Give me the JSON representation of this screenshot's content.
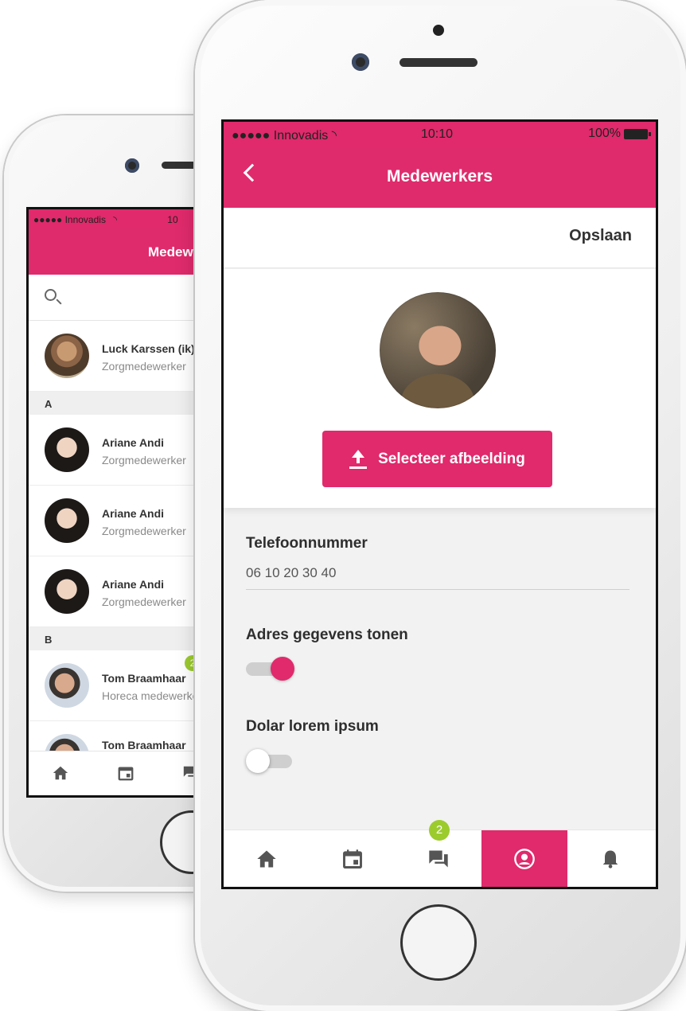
{
  "back_phone": {
    "status": {
      "carrier": "●●●●● Innovadis",
      "time": "10"
    },
    "title": "Medew",
    "contacts": [
      {
        "name": "Luck Karssen (ik)",
        "role": "Zorgmedewerker",
        "avatar": "man"
      }
    ],
    "sections": [
      {
        "letter": "A",
        "items": [
          {
            "name": "Ariane Andi",
            "role": "Zorgmedewerker"
          },
          {
            "name": "Ariane Andi",
            "role": "Zorgmedewerker"
          },
          {
            "name": "Ariane Andi",
            "role": "Zorgmedewerker"
          }
        ]
      },
      {
        "letter": "B",
        "items": [
          {
            "name": "Tom Braamhaar",
            "role": "Horeca medewerker",
            "badge": "2"
          },
          {
            "name": "Tom Braamhaar",
            "role": ""
          }
        ]
      }
    ]
  },
  "status": {
    "carrier": "●●●●● Innovadis",
    "time": "10:10",
    "battery": "100%"
  },
  "nav": {
    "title": "Medewerkers"
  },
  "actions": {
    "save": "Opslaan"
  },
  "profile": {
    "select_label": "Selecteer afbeelding"
  },
  "fields": {
    "phone_label": "Telefoonnummer",
    "phone_value": "06 10 20 30 40",
    "address_label": "Adres gegevens tonen",
    "address_on": true,
    "dolar_label": "Dolar lorem ipsum",
    "dolar_on": false
  },
  "tabs": [
    {
      "icon": "home-icon"
    },
    {
      "icon": "calendar-icon"
    },
    {
      "icon": "chat-icon",
      "badge": "2"
    },
    {
      "icon": "profile-icon",
      "active": true
    },
    {
      "icon": "bell-icon"
    }
  ],
  "colors": {
    "brand": "#e02a6b",
    "badge": "#9ccb2e"
  }
}
